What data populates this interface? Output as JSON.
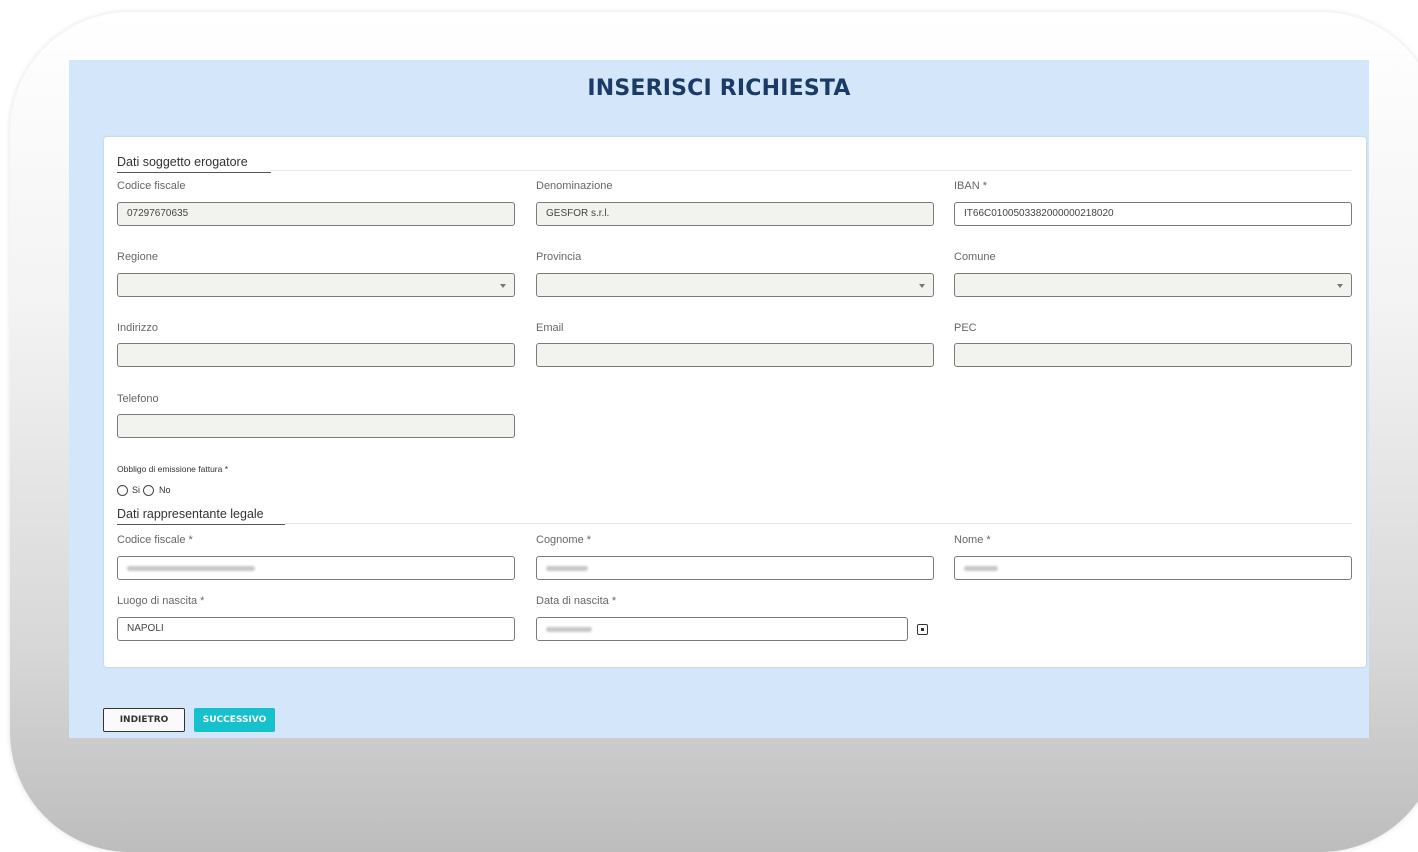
{
  "page": {
    "title": "INSERISCI RICHIESTA"
  },
  "erogatore": {
    "section_title": "Dati soggetto erogatore",
    "codice_fiscale": {
      "label": "Codice fiscale",
      "value": "07297670635"
    },
    "denominazione": {
      "label": "Denominazione",
      "value": "GESFOR s.r.l."
    },
    "iban": {
      "label": "IBAN *",
      "value": "IT66C0100503382000000218020"
    },
    "regione": {
      "label": "Regione",
      "value": ""
    },
    "provincia": {
      "label": "Provincia",
      "value": ""
    },
    "comune": {
      "label": "Comune",
      "value": ""
    },
    "indirizzo": {
      "label": "Indirizzo",
      "value": ""
    },
    "email": {
      "label": "Email",
      "value": ""
    },
    "pec": {
      "label": "PEC",
      "value": ""
    },
    "telefono": {
      "label": "Telefono",
      "value": ""
    },
    "fattura": {
      "label": "Obbligo di emissione fattura *",
      "option_si": "Si",
      "option_no": "No"
    }
  },
  "rappresentante": {
    "section_title": "Dati rappresentante legale",
    "codice_fiscale": {
      "label": "Codice fiscale *"
    },
    "cognome": {
      "label": "Cognome *"
    },
    "nome": {
      "label": "Nome *"
    },
    "luogo_nascita": {
      "label": "Luogo di nascita *",
      "value": "NAPOLI"
    },
    "data_nascita": {
      "label": "Data di nascita *"
    }
  },
  "icons": {
    "select_caret": "chevron-down-icon",
    "calendar": "calendar-icon"
  },
  "buttons": {
    "back": "INDIETRO",
    "next": "SUCCESSIVO"
  },
  "colors": {
    "app_background": "#d3e6fa",
    "title": "#1c3a66",
    "primary_button": "#15c1cd"
  }
}
